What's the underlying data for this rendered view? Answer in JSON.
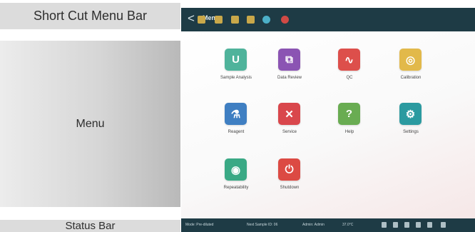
{
  "annotations": {
    "shortcut": "Short Cut Menu Bar",
    "menu": "Menu",
    "status": "Status Bar"
  },
  "topbar": {
    "back": "<",
    "title": "Menu"
  },
  "shortcuts": [
    {
      "name": "sample-shortcut-icon",
      "color": "#c9a84a"
    },
    {
      "name": "review-shortcut-icon",
      "color": "#c9a84a"
    },
    {
      "name": "qc-shortcut-icon",
      "color": "#c9a84a"
    },
    {
      "name": "calibration-shortcut-icon",
      "color": "#c9a84a"
    },
    {
      "name": "reagent-shortcut-icon",
      "color": "#4cb0c8"
    },
    {
      "name": "shutdown-shortcut-icon",
      "color": "#d04a45"
    }
  ],
  "menu": [
    {
      "label": "Sample Analysis",
      "color": "#4fb39b",
      "icon": "tube-icon",
      "glyph": "U"
    },
    {
      "label": "Data Review",
      "color": "#8b54b3",
      "icon": "data-review-icon",
      "glyph": "⧉"
    },
    {
      "label": "QC",
      "color": "#dd4f4b",
      "icon": "qc-icon",
      "glyph": "∿"
    },
    {
      "label": "Calibration",
      "color": "#e2b94a",
      "icon": "calibration-icon",
      "glyph": "◎"
    },
    {
      "label": "Reagent",
      "color": "#3f7fc2",
      "icon": "flask-icon",
      "glyph": "⚗"
    },
    {
      "label": "Service",
      "color": "#d9474c",
      "icon": "tools-icon",
      "glyph": "✕"
    },
    {
      "label": "Help",
      "color": "#69ac52",
      "icon": "help-icon",
      "glyph": "?"
    },
    {
      "label": "Settings",
      "color": "#2b9aa0",
      "icon": "gear-icon",
      "glyph": "⚙"
    },
    {
      "label": "Repeatability",
      "color": "#3aa985",
      "icon": "repeatability-icon",
      "glyph": "◉"
    },
    {
      "label": "Shutdown",
      "color": "#dc4a43",
      "icon": "power-icon",
      "glyph": "⏻"
    }
  ],
  "statusbar": {
    "mode": "Mode: Pre-diluted",
    "next_sample": "Next Sample ID: 06",
    "user": "Admin: Admin",
    "temp": "37.0°C"
  }
}
